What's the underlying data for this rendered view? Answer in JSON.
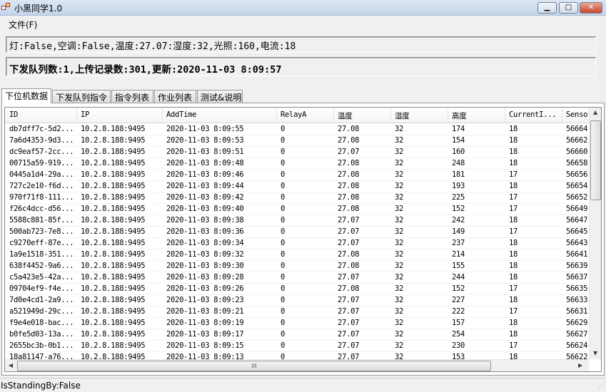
{
  "window": {
    "title": "小黑同学1.0",
    "minimize": "▁",
    "maximize": "□",
    "close": "✕"
  },
  "menu": {
    "file": "文件(F)"
  },
  "status_line": "灯:False,空调:False,温度:27.07:湿度:32,光照:160,电流:18",
  "summary_line": "下发队列数:1,上传记录数:301,更新:2020-11-03 8:09:57",
  "tabs": [
    {
      "label": "下位机数据",
      "active": true
    },
    {
      "label": "下发队列指令"
    },
    {
      "label": "指令列表"
    },
    {
      "label": "作业列表"
    },
    {
      "label": "测试&说明"
    }
  ],
  "grid": {
    "columns": [
      "ID",
      "IP",
      "AddTime",
      "RelayA",
      "温度",
      "湿度",
      "高度",
      "CurrentI...",
      "Senso"
    ],
    "rows": [
      [
        "db7dff7c-5d2...",
        "10.2.8.188:9495",
        "2020-11-03 8:09:55",
        "0",
        "27.08",
        "32",
        "174",
        "18",
        "56664"
      ],
      [
        "7a6d4353-9d3...",
        "10.2.8.188:9495",
        "2020-11-03 8:09:53",
        "0",
        "27.08",
        "32",
        "154",
        "18",
        "56662"
      ],
      [
        "dc9eaf57-2cc...",
        "10.2.8.188:9495",
        "2020-11-03 8:09:51",
        "0",
        "27.07",
        "32",
        "160",
        "18",
        "56660"
      ],
      [
        "00715a59-919...",
        "10.2.8.188:9495",
        "2020-11-03 8:09:48",
        "0",
        "27.08",
        "32",
        "248",
        "18",
        "56658"
      ],
      [
        "0445a1d4-29a...",
        "10.2.8.188:9495",
        "2020-11-03 8:09:46",
        "0",
        "27.08",
        "32",
        "181",
        "17",
        "56656"
      ],
      [
        "727c2e10-f6d...",
        "10.2.8.188:9495",
        "2020-11-03 8:09:44",
        "0",
        "27.08",
        "32",
        "193",
        "18",
        "56654"
      ],
      [
        "970f71f8-111...",
        "10.2.8.188:9495",
        "2020-11-03 8:09:42",
        "0",
        "27.08",
        "32",
        "225",
        "17",
        "56652"
      ],
      [
        "f26c4dcc-d56...",
        "10.2.8.188:9495",
        "2020-11-03 8:09:40",
        "0",
        "27.08",
        "32",
        "152",
        "17",
        "56649"
      ],
      [
        "5588c881-85f...",
        "10.2.8.188:9495",
        "2020-11-03 8:09:38",
        "0",
        "27.07",
        "32",
        "242",
        "18",
        "56647"
      ],
      [
        "500ab723-7e8...",
        "10.2.8.188:9495",
        "2020-11-03 8:09:36",
        "0",
        "27.07",
        "32",
        "149",
        "17",
        "56645"
      ],
      [
        "c9270eff-87e...",
        "10.2.8.188:9495",
        "2020-11-03 8:09:34",
        "0",
        "27.07",
        "32",
        "237",
        "18",
        "56643"
      ],
      [
        "1a9e1518-351...",
        "10.2.8.188:9495",
        "2020-11-03 8:09:32",
        "0",
        "27.08",
        "32",
        "214",
        "18",
        "56641"
      ],
      [
        "638f4452-9a6...",
        "10.2.8.188:9495",
        "2020-11-03 8:09:30",
        "0",
        "27.08",
        "32",
        "155",
        "18",
        "56639"
      ],
      [
        "c5a423e5-42a...",
        "10.2.8.188:9495",
        "2020-11-03 8:09:28",
        "0",
        "27.07",
        "32",
        "244",
        "18",
        "56637"
      ],
      [
        "09704ef9-f4e...",
        "10.2.8.188:9495",
        "2020-11-03 8:09:26",
        "0",
        "27.08",
        "32",
        "152",
        "17",
        "56635"
      ],
      [
        "7d0e4cd1-2a9...",
        "10.2.8.188:9495",
        "2020-11-03 8:09:23",
        "0",
        "27.07",
        "32",
        "227",
        "18",
        "56633"
      ],
      [
        "a521949d-29c...",
        "10.2.8.188:9495",
        "2020-11-03 8:09:21",
        "0",
        "27.07",
        "32",
        "222",
        "17",
        "56631"
      ],
      [
        "f9e4e018-bac...",
        "10.2.8.188:9495",
        "2020-11-03 8:09:19",
        "0",
        "27.07",
        "32",
        "157",
        "18",
        "56629"
      ],
      [
        "b0fe5d03-13a...",
        "10.2.8.188:9495",
        "2020-11-03 8:09:17",
        "0",
        "27.07",
        "32",
        "254",
        "18",
        "56627"
      ],
      [
        "2655bc3b-0b1...",
        "10.2.8.188:9495",
        "2020-11-03 8:09:15",
        "0",
        "27.07",
        "32",
        "230",
        "17",
        "56624"
      ],
      [
        "18a81147-a76...",
        "10.2.8.188:9495",
        "2020-11-03 8:09:13",
        "0",
        "27.07",
        "32",
        "153",
        "18",
        "56622"
      ]
    ],
    "hscroll_grip": "III"
  },
  "statusbar": {
    "text": "IsStandingBy:False"
  }
}
